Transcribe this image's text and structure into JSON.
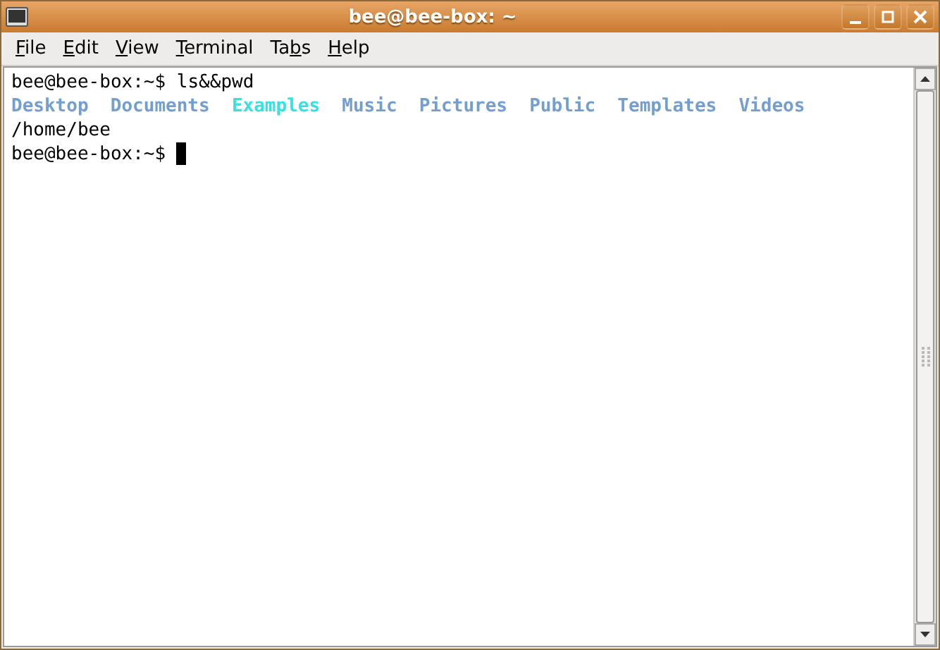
{
  "window": {
    "title": "bee@bee-box: ~"
  },
  "menu": [
    {
      "key": "F",
      "after": "ile"
    },
    {
      "key": "E",
      "after": "dit"
    },
    {
      "key": "V",
      "after": "iew"
    },
    {
      "key": "T",
      "after": "erminal"
    },
    {
      "before": "Ta",
      "key": "b",
      "after": "s"
    },
    {
      "key": "H",
      "after": "elp"
    }
  ],
  "terminal": {
    "lines": [
      {
        "kind": "text",
        "text": "bee@bee-box:~$ ls&&pwd"
      },
      {
        "kind": "listing",
        "entries": [
          {
            "name": "Desktop",
            "color": "#729fcf"
          },
          {
            "name": "Documents",
            "color": "#729fcf"
          },
          {
            "name": "Examples",
            "color": "#34e2e2"
          },
          {
            "name": "Music",
            "color": "#729fcf"
          },
          {
            "name": "Pictures",
            "color": "#729fcf"
          },
          {
            "name": "Public",
            "color": "#729fcf"
          },
          {
            "name": "Templates",
            "color": "#729fcf"
          },
          {
            "name": "Videos",
            "color": "#729fcf"
          }
        ]
      },
      {
        "kind": "text",
        "text": "/home/bee"
      },
      {
        "kind": "prompt",
        "text": "bee@bee-box:~$ "
      }
    ]
  }
}
